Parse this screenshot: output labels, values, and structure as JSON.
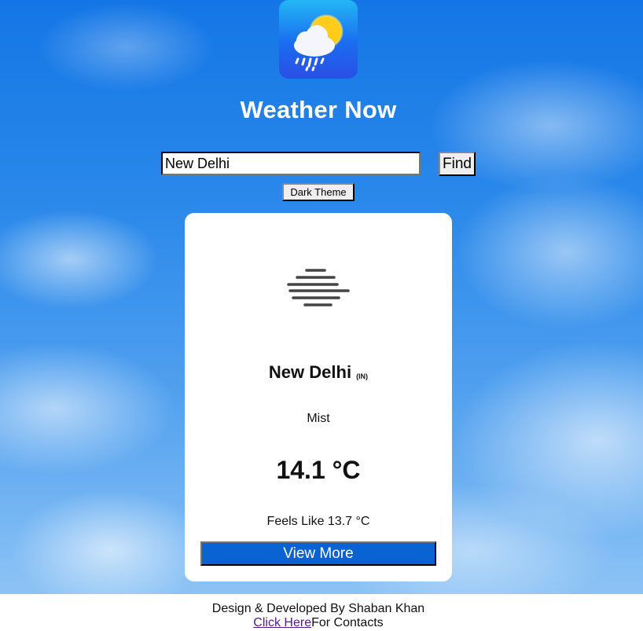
{
  "app": {
    "logo_icon": "weather-cloud-sun-rain-icon",
    "title": "Weather Now"
  },
  "search": {
    "value": "New Delhi",
    "find_label": "Find"
  },
  "theme_toggle": {
    "label": "Dark Theme"
  },
  "card": {
    "icon": "mist-icon",
    "city": "New Delhi",
    "country": "(IN)",
    "condition": "Mist",
    "temperature": "14.1 °C",
    "feels_like": "Feels Like 13.7 °C",
    "view_more_label": "View More",
    "button_color": "#0a63d2"
  },
  "footer": {
    "credit": "Design & Developed By Shaban Khan",
    "link_text": "Click Here",
    "link_suffix": "For Contacts"
  }
}
